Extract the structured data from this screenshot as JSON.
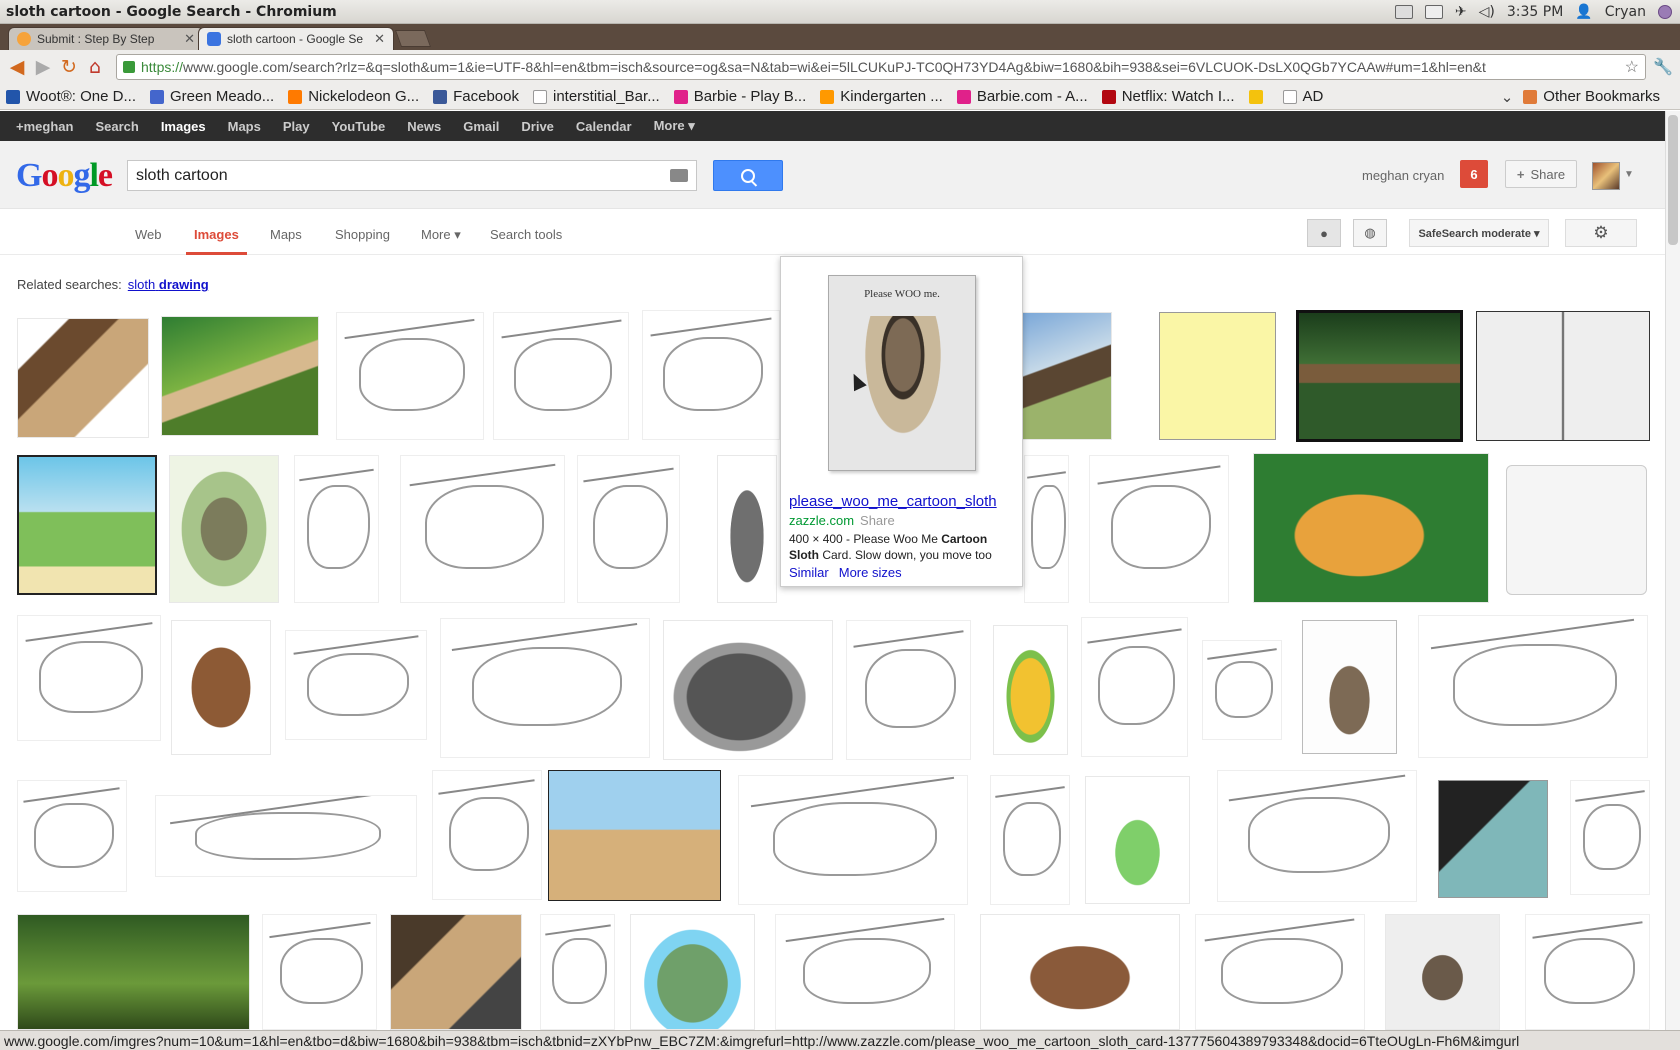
{
  "window": {
    "title": "sloth cartoon - Google Search - Chromium",
    "clock": "3:35 PM",
    "username": "Cryan"
  },
  "tabs": [
    {
      "label": "Submit : Step By Step",
      "icon": "stepbystep-favicon-icon",
      "active": false
    },
    {
      "label": "sloth cartoon - Google Se",
      "icon": "google-favicon-icon",
      "active": true
    }
  ],
  "omnibox": {
    "scheme": "https://",
    "url_rest": "www.google.com/search?rlz=&q=sloth&um=1&ie=UTF-8&hl=en&tbm=isch&source=og&sa=N&tab=wi&ei=5lLCUKuPJ-TC0QH73YD4Ag&biw=1680&bih=938&sei=6VLCUOK-DsLX0QGb7YCAAw#um=1&hl=en&t"
  },
  "bookmarks": [
    {
      "label": "Woot®: One D...",
      "color": "#2255aa"
    },
    {
      "label": "Green Meado...",
      "color": "#4466cc"
    },
    {
      "label": "Nickelodeon G...",
      "color": "#ff7a00"
    },
    {
      "label": "Facebook",
      "color": "#3b5998"
    },
    {
      "label": "interstitial_Bar...",
      "color": "#cccccc"
    },
    {
      "label": "Barbie - Play B...",
      "color": "#e0218a"
    },
    {
      "label": "Kindergarten ...",
      "color": "#ff9900"
    },
    {
      "label": "Barbie.com - A...",
      "color": "#e0218a"
    },
    {
      "label": "Netflix: Watch I...",
      "color": "#b20710"
    },
    {
      "label": "",
      "color": "#f4c20d"
    },
    {
      "label": "AD",
      "color": "#cccccc"
    }
  ],
  "other_bookmarks": "Other Bookmarks",
  "gbar": [
    "+meghan",
    "Search",
    "Images",
    "Maps",
    "Play",
    "YouTube",
    "News",
    "Gmail",
    "Drive",
    "Calendar",
    "More ▾"
  ],
  "search": {
    "query": "sloth cartoon"
  },
  "user": {
    "name": "meghan cryan",
    "notifications": "6",
    "share_label": "Share"
  },
  "nav_tabs": [
    "Web",
    "Images",
    "Maps",
    "Shopping",
    "More ▾",
    "Search tools"
  ],
  "safesearch": "SafeSearch moderate ▾",
  "related": {
    "label": "Related searches:",
    "prefix": "sloth",
    "term": "drawing"
  },
  "preview": {
    "image_caption": "Please WOO me.",
    "title": "please_woo_me_cartoon_sloth",
    "domain": "zazzle.com",
    "share": "Share",
    "desc_pre": "400 × 400 - Please Woo Me ",
    "desc_bold1": "Cartoon",
    "desc_bold2": "Sloth",
    "desc_post": " Card. Slow down, you move too",
    "similar": "Similar",
    "more_sizes": "More sizes"
  },
  "statusbar": "www.google.com/imgres?num=10&um=1&hl=en&tbo=d&biw=1680&bih=938&tbm=isch&tbnid=zXYbPnw_EBC7ZM:&imgrefurl=http://www.zazzle.com/please_woo_me_cartoon_sloth_card-137775604389793348&docid=6TteOUgLn-Fh6M&imgurl"
}
